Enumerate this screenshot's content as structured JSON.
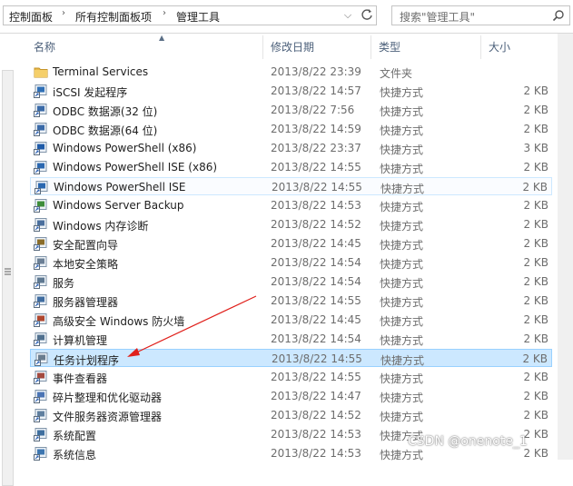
{
  "address": {
    "crumbs": [
      "控制面板",
      "所有控制面板项",
      "管理工具"
    ],
    "dropdown_icon": "chevron-down-icon",
    "refresh_icon": "refresh-icon"
  },
  "search": {
    "placeholder": "搜索\"管理工具\""
  },
  "columns": {
    "name": "名称",
    "date": "修改日期",
    "type": "类型",
    "size": "大小"
  },
  "rows": [
    {
      "name": "Terminal Services",
      "date": "2013/8/22 23:39",
      "type": "文件夹",
      "size": "",
      "icon": "folder-icon"
    },
    {
      "name": "iSCSI 发起程序",
      "date": "2013/8/22 14:57",
      "type": "快捷方式",
      "size": "2 KB",
      "icon": "iscsi-icon"
    },
    {
      "name": "ODBC 数据源(32 位)",
      "date": "2013/8/22 7:56",
      "type": "快捷方式",
      "size": "2 KB",
      "icon": "odbc-icon"
    },
    {
      "name": "ODBC 数据源(64 位)",
      "date": "2013/8/22 14:59",
      "type": "快捷方式",
      "size": "2 KB",
      "icon": "odbc-icon"
    },
    {
      "name": "Windows PowerShell (x86)",
      "date": "2013/8/22 23:37",
      "type": "快捷方式",
      "size": "3 KB",
      "icon": "powershell-icon"
    },
    {
      "name": "Windows PowerShell ISE (x86)",
      "date": "2013/8/22 14:55",
      "type": "快捷方式",
      "size": "2 KB",
      "icon": "powershell-ise-icon"
    },
    {
      "name": "Windows PowerShell ISE",
      "date": "2013/8/22 14:55",
      "type": "快捷方式",
      "size": "2 KB",
      "icon": "powershell-ise-icon"
    },
    {
      "name": "Windows Server Backup",
      "date": "2013/8/22 14:53",
      "type": "快捷方式",
      "size": "2 KB",
      "icon": "backup-icon"
    },
    {
      "name": "Windows 内存诊断",
      "date": "2013/8/22 14:52",
      "type": "快捷方式",
      "size": "2 KB",
      "icon": "memory-diagnostic-icon"
    },
    {
      "name": "安全配置向导",
      "date": "2013/8/22 14:45",
      "type": "快捷方式",
      "size": "2 KB",
      "icon": "security-wizard-icon"
    },
    {
      "name": "本地安全策略",
      "date": "2013/8/22 14:54",
      "type": "快捷方式",
      "size": "2 KB",
      "icon": "security-policy-icon"
    },
    {
      "name": "服务",
      "date": "2013/8/22 14:54",
      "type": "快捷方式",
      "size": "2 KB",
      "icon": "services-icon"
    },
    {
      "name": "服务器管理器",
      "date": "2013/8/22 14:55",
      "type": "快捷方式",
      "size": "2 KB",
      "icon": "server-manager-icon"
    },
    {
      "name": "高级安全 Windows 防火墙",
      "date": "2013/8/22 14:45",
      "type": "快捷方式",
      "size": "2 KB",
      "icon": "firewall-icon"
    },
    {
      "name": "计算机管理",
      "date": "2013/8/22 14:54",
      "type": "快捷方式",
      "size": "2 KB",
      "icon": "computer-management-icon"
    },
    {
      "name": "任务计划程序",
      "date": "2013/8/22 14:55",
      "type": "快捷方式",
      "size": "2 KB",
      "icon": "task-scheduler-icon"
    },
    {
      "name": "事件查看器",
      "date": "2013/8/22 14:55",
      "type": "快捷方式",
      "size": "2 KB",
      "icon": "event-viewer-icon"
    },
    {
      "name": "碎片整理和优化驱动器",
      "date": "2013/8/22 14:47",
      "type": "快捷方式",
      "size": "2 KB",
      "icon": "defrag-icon"
    },
    {
      "name": "文件服务器资源管理器",
      "date": "2013/8/22 14:52",
      "type": "快捷方式",
      "size": "2 KB",
      "icon": "file-server-icon"
    },
    {
      "name": "系统配置",
      "date": "2013/8/22 14:53",
      "type": "快捷方式",
      "size": "2 KB",
      "icon": "msconfig-icon"
    },
    {
      "name": "系统信息",
      "date": "2013/8/22 14:53",
      "type": "快捷方式",
      "size": "2 KB",
      "icon": "system-info-icon"
    }
  ],
  "selected_row": 15,
  "hover_row": 6,
  "colors": {
    "selected": "#cce8ff",
    "selected_border": "#99d1ff",
    "arrow": "#e0201b",
    "header_text": "#4c607a"
  },
  "watermark": "CSDN @onenote_1"
}
